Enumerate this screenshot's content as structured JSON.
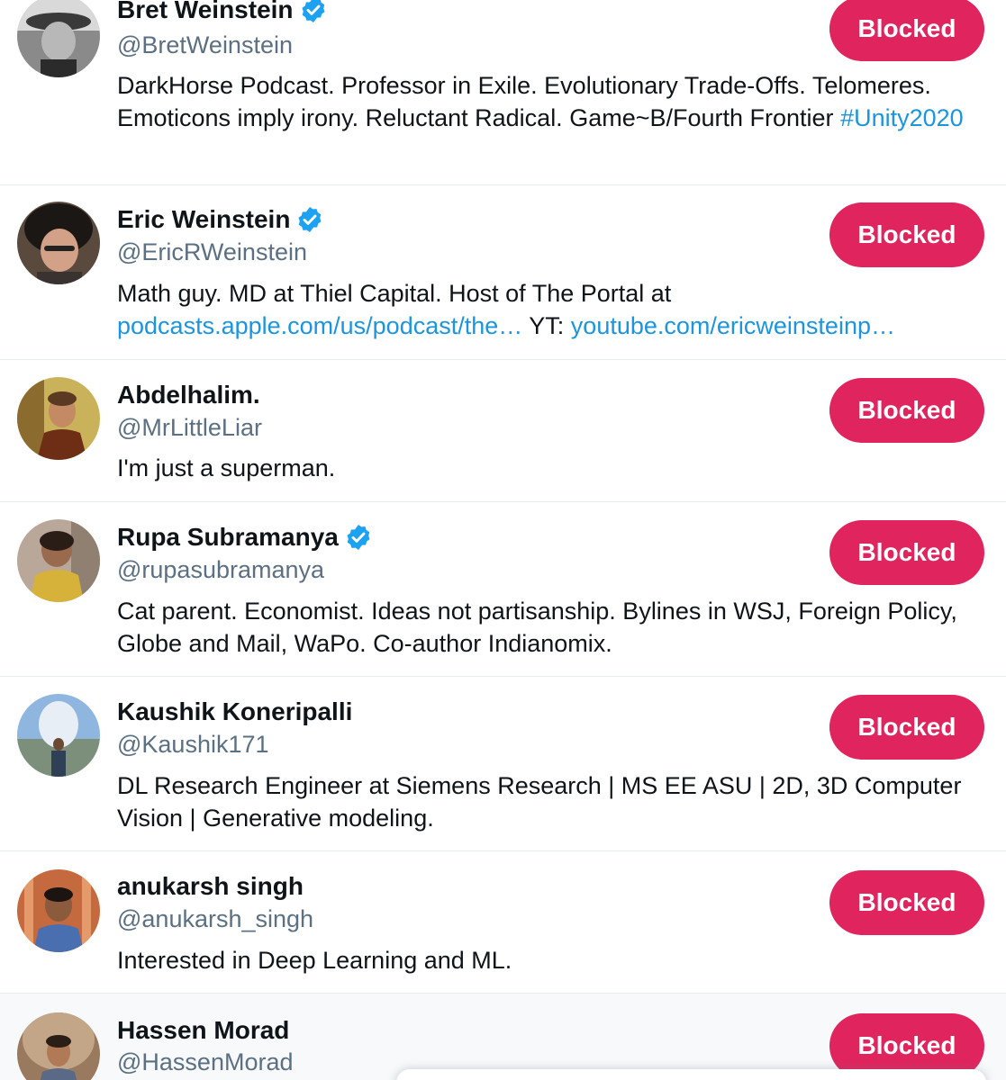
{
  "button_label": "Blocked",
  "colors": {
    "blocked_button": "#e0245e",
    "link": "#1b95e0",
    "handle": "#5b7083",
    "verified_badge": "#1da1f2"
  },
  "users": [
    {
      "name": "Bret Weinstein",
      "verified": true,
      "handle": "@BretWeinstein",
      "bio_parts": [
        "DarkHorse Podcast. Professor in Exile. Evolutionary Trade-Offs. Telomeres. Emoticons imply irony. Reluctant Radical. Game~B/Fourth Frontier ",
        "#Unity2020"
      ]
    },
    {
      "name": "Eric Weinstein",
      "verified": true,
      "handle": "@EricRWeinstein",
      "bio_parts": [
        "Math guy. MD at Thiel Capital. Host of The Portal at ",
        "podcasts.apple.com/us/podcast/the…",
        " YT: ",
        "youtube.com/ericweinsteinp…"
      ]
    },
    {
      "name": "Abdelhalim.",
      "verified": false,
      "handle": "@MrLittleLiar",
      "bio": "I'm just a superman."
    },
    {
      "name": "Rupa Subramanya",
      "verified": true,
      "handle": "@rupasubramanya",
      "bio": "Cat parent. Economist. Ideas not partisanship. Bylines in WSJ, Foreign Policy, Globe and Mail, WaPo. Co-author Indianomix."
    },
    {
      "name": "Kaushik Koneripalli",
      "verified": false,
      "handle": "@Kaushik171",
      "bio": "DL Research Engineer at Siemens Research | MS EE ASU | 2D, 3D Computer Vision | Generative modeling."
    },
    {
      "name": "anukarsh singh",
      "verified": false,
      "handle": "@anukarsh_singh",
      "bio": "Interested in Deep Learning and ML."
    },
    {
      "name": "Hassen Morad",
      "verified": false,
      "handle": "@HassenMorad"
    }
  ]
}
